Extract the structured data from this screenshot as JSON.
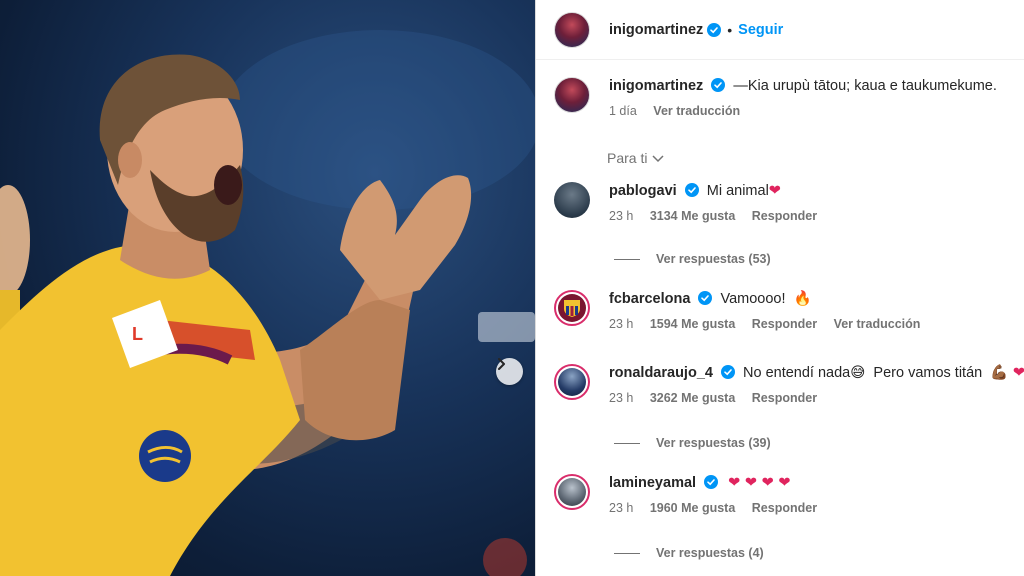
{
  "post": {
    "author": "inigomartinez",
    "follow_label": "Seguir",
    "dot": "•",
    "next_icon": "chevron-right-icon"
  },
  "caption": {
    "username": "inigomartinez",
    "text": "—Kia urupù tātou; kaua e taukumekume.",
    "time": "1 día",
    "translate": "Ver traducción"
  },
  "sort": {
    "label": "Para ti"
  },
  "comments": [
    {
      "username": "pablogavi",
      "text": "Mi animal",
      "emoji": "❤",
      "time": "23 h",
      "likes": "3134 Me gusta",
      "reply": "Responder",
      "view_replies": "Ver respuestas (53)"
    },
    {
      "username": "fcbarcelona",
      "text": "Vamoooo!",
      "emoji": "🔥",
      "time": "23 h",
      "likes": "1594 Me gusta",
      "reply": "Responder",
      "translate": "Ver traducción"
    },
    {
      "username": "ronaldaraujo_4",
      "text": "No entendí nada",
      "emoji": "😅",
      "text2": "Pero vamos titán",
      "emoji2": "💪🏾 ❤",
      "time": "23 h",
      "likes": "3262 Me gusta",
      "reply": "Responder",
      "view_replies": "Ver respuestas (39)"
    },
    {
      "username": "lamineyamal",
      "text": "",
      "emoji": "❤ ❤ ❤ ❤",
      "time": "23 h",
      "likes": "1960 Me gusta",
      "reply": "Responder",
      "view_replies": "Ver respuestas (4)"
    }
  ],
  "colors": {
    "accent": "#0095f6",
    "verified": "#0095f6",
    "secondary_text": "#737373",
    "heart": "#e0245e",
    "story_ring": "#d92d6b",
    "jersey": "#f2c230"
  }
}
